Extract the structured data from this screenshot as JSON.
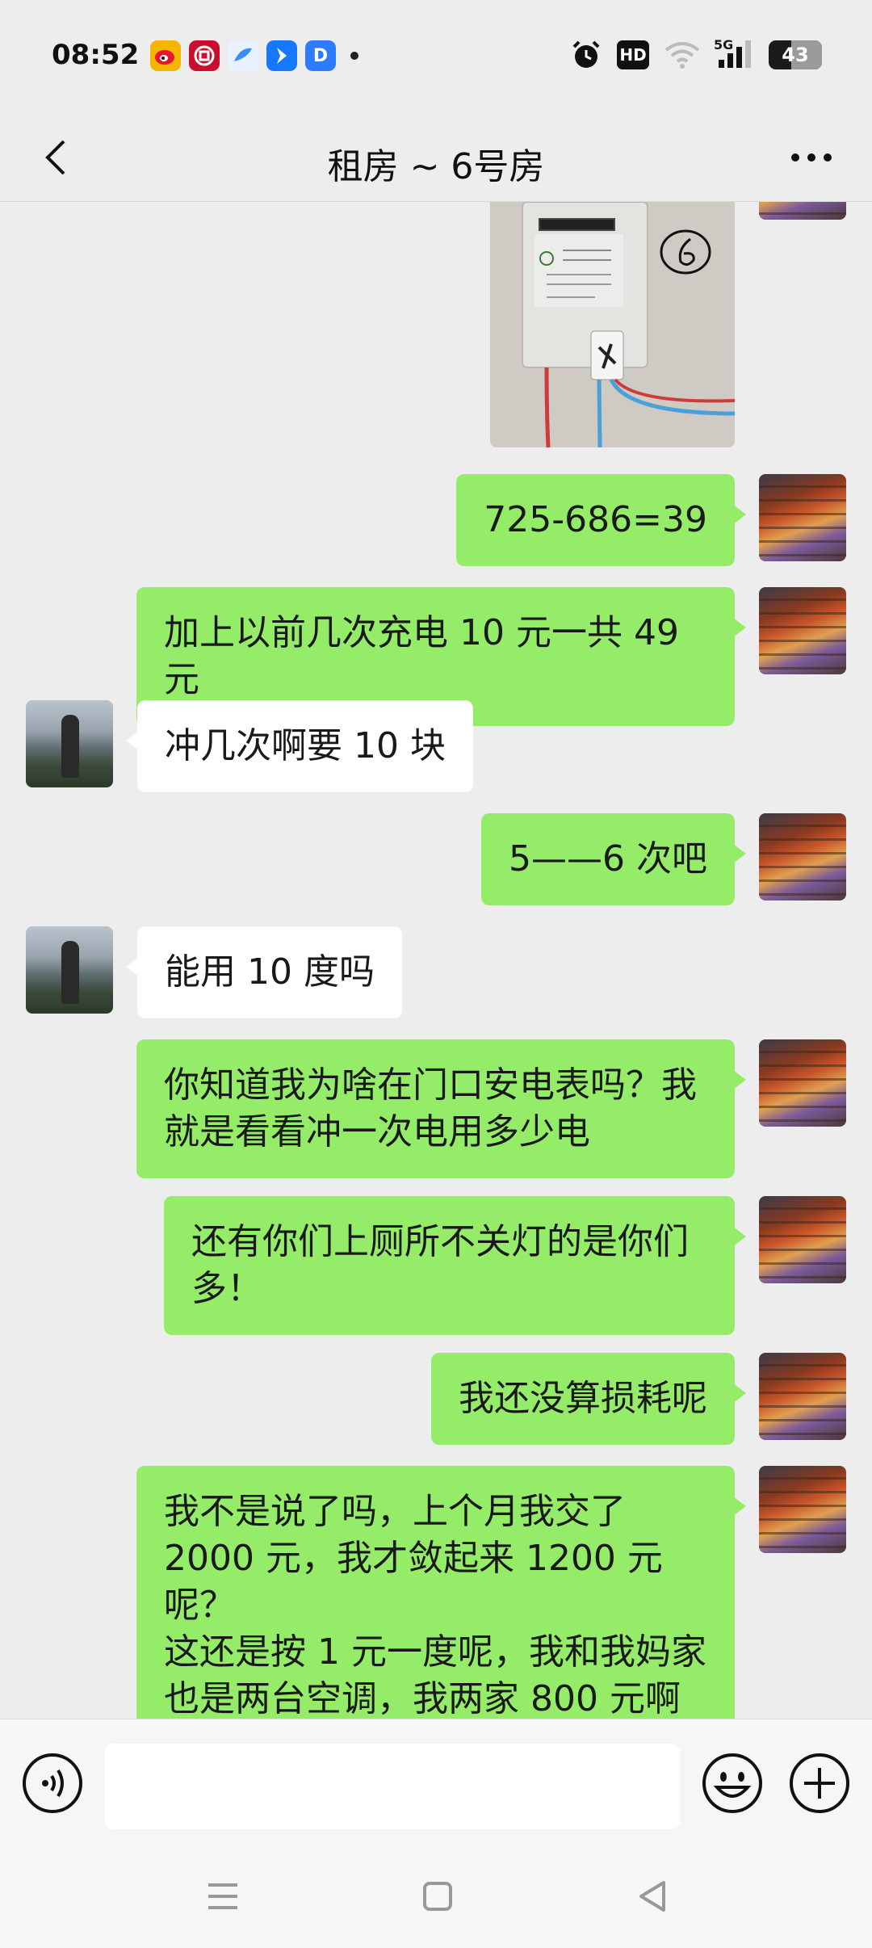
{
  "status_bar": {
    "time": "08:52",
    "app_icons": [
      {
        "icon": "weibo-icon",
        "color": "#f5b400"
      },
      {
        "icon": "bank-icon",
        "color": "#c8102e"
      },
      {
        "icon": "bird-icon",
        "color": "#5aa0ff"
      },
      {
        "icon": "arrow-app-icon",
        "color": "#1677ff"
      },
      {
        "icon": "d-app-icon",
        "color": "#2f7bff",
        "letter": "D"
      }
    ],
    "hd_label": "HD",
    "network_label": "5G",
    "battery_level": "43"
  },
  "header": {
    "title": "租房 ~ 6号房",
    "back_icon": "chevron-left-icon",
    "more_icon": "more-dots-icon"
  },
  "messages": [
    {
      "sender": "me",
      "type": "image",
      "description_icon": "electric-meter-photo"
    },
    {
      "sender": "me",
      "text": "725-686=39"
    },
    {
      "sender": "me",
      "text": "加上以前几次充电 10 元一共 49 元"
    },
    {
      "sender": "other",
      "text": "冲几次啊要 10 块"
    },
    {
      "sender": "me",
      "text": "5——6 次吧"
    },
    {
      "sender": "other",
      "text": "能用 10 度吗"
    },
    {
      "sender": "me",
      "lines": [
        "你知道我为啥在门口安电表吗？我",
        "就是看看冲一次电用多少电"
      ]
    },
    {
      "sender": "me",
      "lines": [
        "还有你们上厕所不关灯的是你们",
        "多！"
      ]
    },
    {
      "sender": "me",
      "text": "我还没算损耗呢"
    },
    {
      "sender": "me",
      "lines": [
        "我不是说了吗，上个月我交了",
        "2000 元，我才敛起来 1200 元呢？",
        "这还是按 1 元一度呢，我和我妈家",
        "也是两台空调，我两家 800 元啊"
      ]
    }
  ],
  "input_bar": {
    "voice_icon": "voice-icon",
    "emoji_icon": "emoji-icon",
    "plus_icon": "plus-circle-icon",
    "input_value": ""
  },
  "nav_bar": {
    "menu_icon": "menu-icon",
    "home_icon": "home-square-icon",
    "back_icon": "back-triangle-icon"
  }
}
